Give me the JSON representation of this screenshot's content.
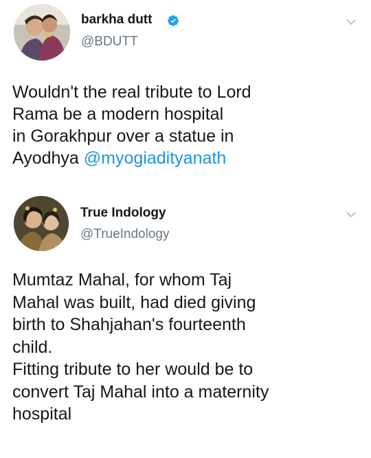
{
  "tweets": [
    {
      "display_name": "barkha dutt",
      "handle": "@BDUTT",
      "verified": true,
      "body": "Wouldn't the real tribute to Lord\nRama be a modern hospital\nin Gorakhpur over a statue in\nAyodhya ",
      "mention": "@myogiadityanath",
      "avatar_icon": "profile-photo-icon"
    },
    {
      "display_name": "True Indology",
      "handle": "@TrueIndology",
      "verified": false,
      "body": "Mumtaz Mahal, for whom Taj\nMahal was built, had died giving\nbirth to Shahjahan's fourteenth\nchild.\nFitting tribute to her would be to\nconvert Taj Mahal into a maternity\nhospital",
      "avatar_icon": "profile-painting-icon"
    }
  ],
  "colors": {
    "text": "#14171a",
    "secondary": "#657786",
    "link": "#1b95e0",
    "verified": "#1da1f2",
    "caret": "#aab8c2"
  },
  "icons": {
    "verified": "verified-badge-icon",
    "caret": "chevron-down-icon"
  }
}
